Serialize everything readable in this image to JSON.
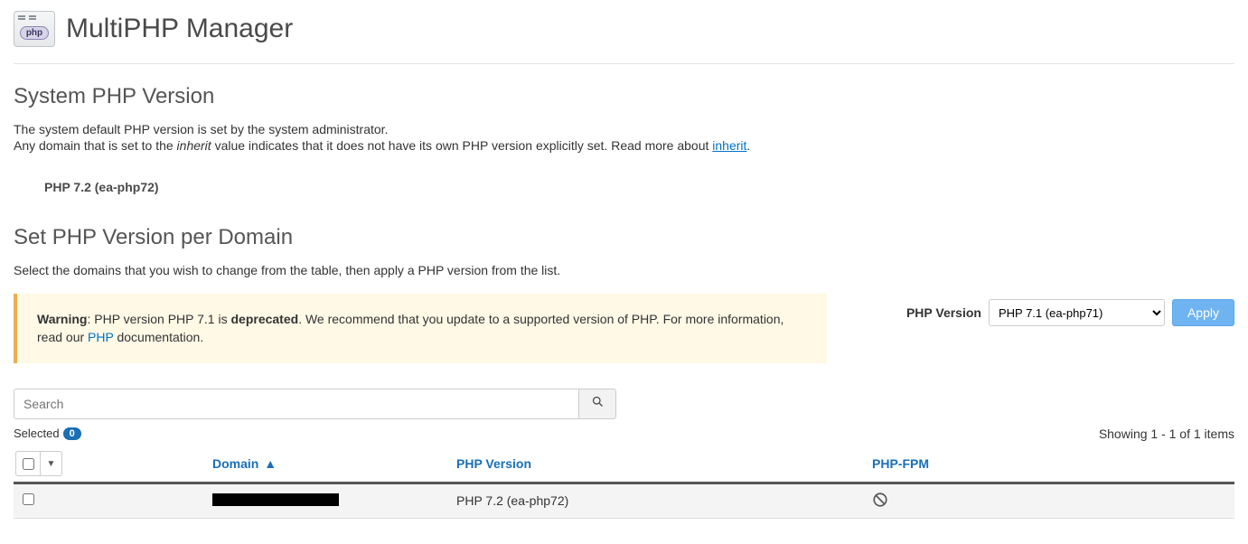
{
  "header": {
    "title": "MultiPHP Manager",
    "icon_name": "php-window-icon",
    "icon_text": "php"
  },
  "system_section": {
    "heading": "System PHP Version",
    "line1": "The system default PHP version is set by the system administrator.",
    "line2_prefix": "Any domain that is set to the ",
    "line2_inherit": "inherit",
    "line2_middle": " value indicates that it does not have its own PHP version explicitly set. Read more about ",
    "line2_link": "inherit",
    "line2_suffix": ".",
    "current_version": "PHP 7.2 (ea-php72)"
  },
  "set_version_section": {
    "heading": "Set PHP Version per Domain",
    "intro": "Select the domains that you wish to change from the table, then apply a PHP version from the list."
  },
  "warning": {
    "label": "Warning",
    "text_mid_prefix": ": PHP version PHP 7.1 is ",
    "deprecated": "deprecated",
    "text_mid_suffix": ". We recommend that you update to a supported version of PHP. For more information, read our ",
    "link": "PHP",
    "text_end": " documentation."
  },
  "php_version_picker": {
    "label": "PHP Version",
    "selected": "PHP 7.1 (ea-php71)",
    "apply_label": "Apply"
  },
  "search": {
    "placeholder": "Search"
  },
  "selection": {
    "label": "Selected",
    "count": "0"
  },
  "pagination": {
    "text": "Showing 1 - 1 of 1 items"
  },
  "columns": {
    "domain": "Domain",
    "sort_arrow": "▲",
    "php_version": "PHP Version",
    "php_fpm": "PHP-FPM"
  },
  "rows": [
    {
      "domain_redacted": true,
      "php_version": "PHP 7.2 (ea-php72)",
      "fpm_state": "disabled"
    }
  ]
}
